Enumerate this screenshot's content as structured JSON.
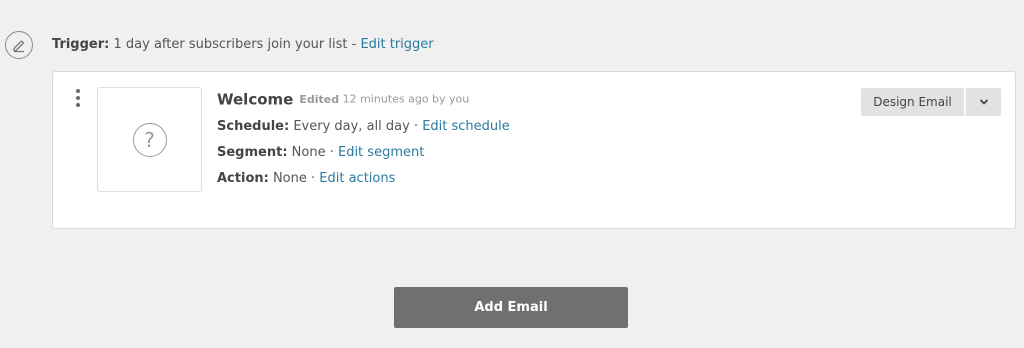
{
  "trigger": {
    "label": "Trigger:",
    "text": " 1 day after subscribers join your list - ",
    "edit_link": "Edit trigger",
    "icon": "pencil-icon"
  },
  "email": {
    "name": "Welcome",
    "edited_label": "Edited",
    "edited_when": " 12 minutes ago by you",
    "thumbnail_icon": "question-icon",
    "schedule_label": "Schedule:",
    "schedule_value": " Every day, all day · ",
    "schedule_link": "Edit schedule",
    "segment_label": "Segment:",
    "segment_value": " None · ",
    "segment_link": "Edit segment",
    "action_label": "Action:",
    "action_value": " None · ",
    "action_link": "Edit actions",
    "thumbnail_glyph": "?"
  },
  "buttons": {
    "design_email": "Design Email",
    "dropdown_icon": "chevron-down-icon",
    "add_email": "Add Email"
  }
}
